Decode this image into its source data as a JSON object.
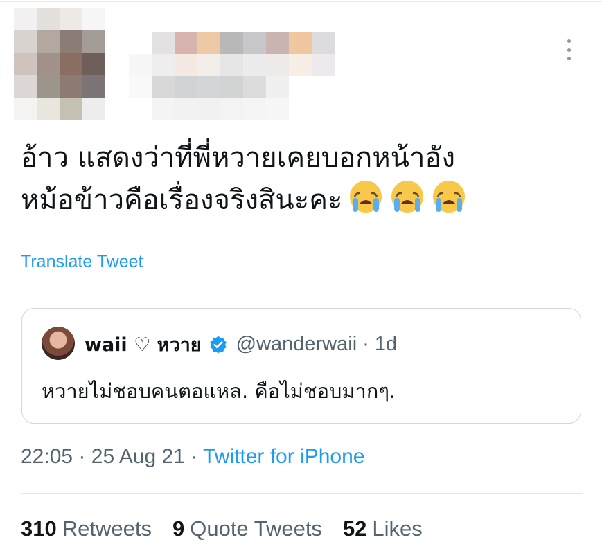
{
  "tweet": {
    "text_line1": "อ้าว แสดงว่าที่พี่หวายเคยบอกหน้าอัง",
    "text_line2": "หม้อข้าวคือเรื่องจริงสินะคะ",
    "emoji": [
      "loudly-crying-face",
      "loudly-crying-face",
      "loudly-crying-face"
    ],
    "translate_label": "Translate Tweet",
    "time": "22:05",
    "date": "25 Aug 21",
    "separator": "·",
    "source": "Twitter for iPhone"
  },
  "quote": {
    "name": "waii ♡ หวาย",
    "handle": "@wanderwaii",
    "separator": "·",
    "age": "1d",
    "text": "หวายไม่ชอบคนตอแหล. คือไม่ชอบมากๆ."
  },
  "stats": {
    "retweets_count": "310",
    "retweets_label": "Retweets",
    "quotes_count": "9",
    "quotes_label": "Quote Tweets",
    "likes_count": "52",
    "likes_label": "Likes"
  },
  "colors": {
    "link": "#1d9bf0",
    "secondary_text": "#536471",
    "verified": "#1d9bf0"
  }
}
